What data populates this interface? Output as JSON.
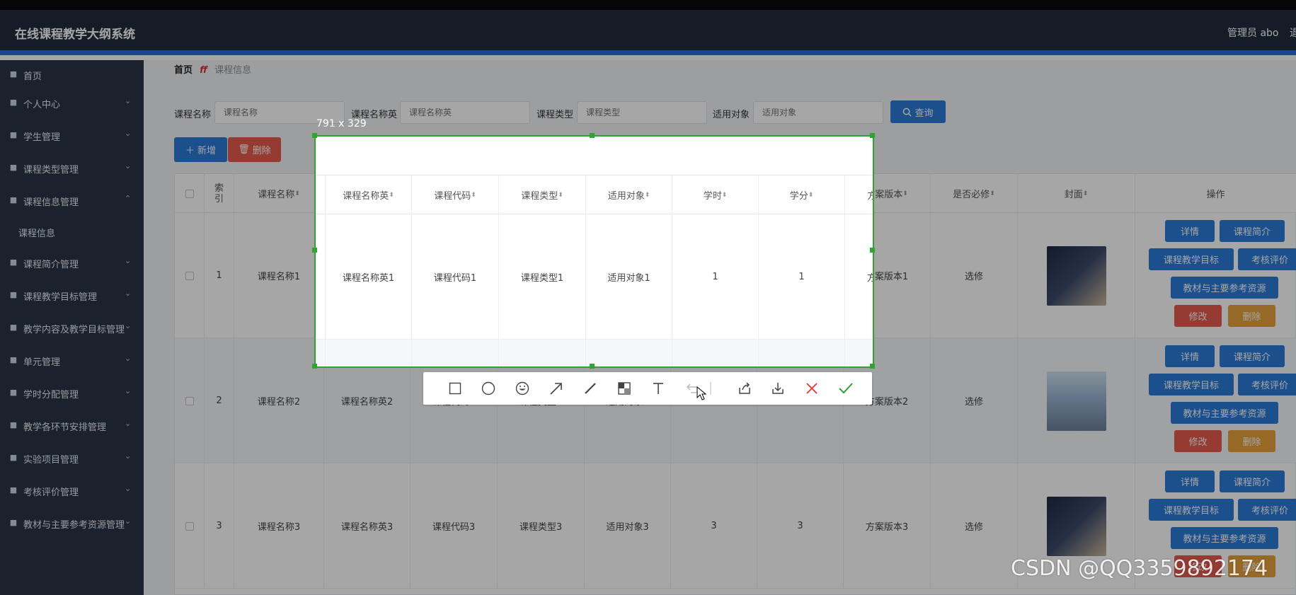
{
  "app": {
    "title": "在线课程教学大纲系统",
    "user": "管理员 abo",
    "logout": "退"
  },
  "sidebar": {
    "items": [
      {
        "label": "首页",
        "icon": "home-icon",
        "chevron": false
      },
      {
        "label": "个人中心",
        "icon": "user-icon",
        "chevron": true
      },
      {
        "label": "学生管理",
        "icon": "clock-icon",
        "chevron": true
      },
      {
        "label": "课程类型管理",
        "icon": "user-icon",
        "chevron": true
      },
      {
        "label": "课程信息管理",
        "icon": "clipboard-icon",
        "chevron": true,
        "expanded": true
      },
      {
        "label": "课程信息",
        "icon": "",
        "chevron": false,
        "sub": true
      },
      {
        "label": "课程简介管理",
        "icon": "flag-icon",
        "chevron": true
      },
      {
        "label": "课程教学目标管理",
        "icon": "grid-icon",
        "chevron": true
      },
      {
        "label": "教学内容及教学目标管理",
        "icon": "crop-icon",
        "chevron": true
      },
      {
        "label": "单元管理",
        "icon": "clipboard-icon",
        "chevron": true
      },
      {
        "label": "学时分配管理",
        "icon": "cup-icon",
        "chevron": true
      },
      {
        "label": "教学各环节安排管理",
        "icon": "monitor-icon",
        "chevron": true
      },
      {
        "label": "实验项目管理",
        "icon": "suitcase-icon",
        "chevron": true
      },
      {
        "label": "考核评价管理",
        "icon": "mic-icon",
        "chevron": true
      },
      {
        "label": "教材与主要参考资源管理",
        "icon": "chat-icon",
        "chevron": true
      }
    ]
  },
  "breadcrumb": {
    "home": "首页",
    "sep": "ff",
    "current": "课程信息"
  },
  "search": {
    "name_label": "课程名称",
    "name_placeholder": "课程名称",
    "name_en_label": "课程名称英",
    "name_en_placeholder": "课程名称英",
    "type_label": "课程类型",
    "type_placeholder": "课程类型",
    "target_label": "适用对象",
    "target_placeholder": "适用对象",
    "query_button": "查询"
  },
  "actions": {
    "add": "新增",
    "delete": "删除"
  },
  "table": {
    "headers": [
      "索引",
      "课程名称",
      "课程名称英",
      "课程代码",
      "课程类型",
      "适用对象",
      "学时",
      "学分",
      "方案版本",
      "是否必修",
      "封面",
      "操作"
    ],
    "index_header_lines": [
      "索",
      "引"
    ],
    "rows": [
      {
        "index": "1",
        "name": "课程名称1",
        "name_en": "课程名称英1",
        "code": "课程代码1",
        "type": "课程类型1",
        "target": "适用对象1",
        "hours": "1",
        "credits": "1",
        "version": "方案版本1",
        "required": "选修",
        "cover": "cover-image-dark"
      },
      {
        "index": "2",
        "name": "课程名称2",
        "name_en": "课程名称英2",
        "code": "课程代码2",
        "type": "课程类型2",
        "target": "适用对象2",
        "hours": "2",
        "credits": "2",
        "version": "方案版本2",
        "required": "选修",
        "cover": "cover-image-hello"
      },
      {
        "index": "3",
        "name": "课程名称3",
        "name_en": "课程名称英3",
        "code": "课程代码3",
        "type": "课程类型3",
        "target": "适用对象3",
        "hours": "3",
        "credits": "3",
        "version": "方案版本3",
        "required": "选修",
        "cover": "cover-image-dark"
      }
    ],
    "op_labels": {
      "detail": "详情",
      "intro": "课程简介",
      "goal": "课程教学目标",
      "eval": "考核评价",
      "resource": "教材与主要参考资源",
      "edit": "修改",
      "remove": "删除"
    }
  },
  "capture": {
    "size_label": "791 x 329"
  },
  "watermark": "CSDN @QQ3359892174",
  "colors": {
    "primary": "#2b7bd7",
    "danger": "#e55b4e",
    "warning": "#e6a23c",
    "sidebar": "#283645",
    "capture_border": "#2ea52e"
  }
}
